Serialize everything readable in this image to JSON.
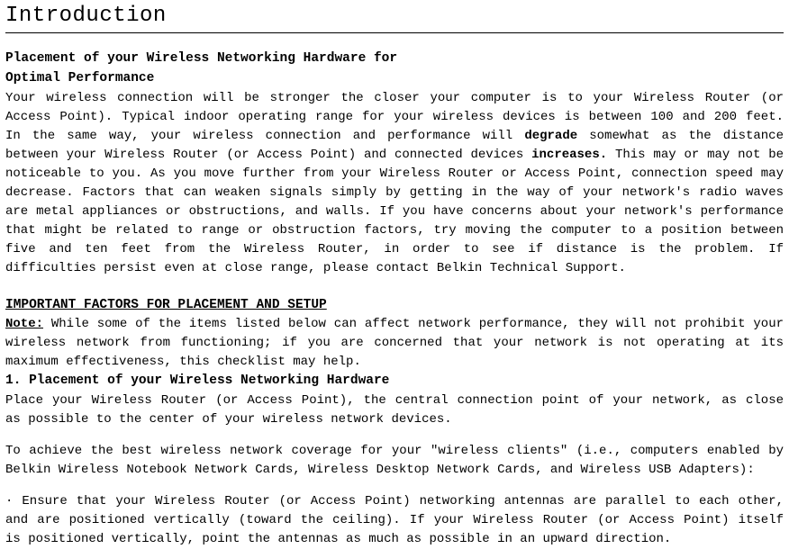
{
  "title": "Introduction",
  "heading_placement_line1": "Placement of your Wireless Networking Hardware for",
  "heading_placement_line2": "Optimal Performance",
  "body1_part1": "Your wireless connection will be stronger the closer your computer is to your Wireless Router (or Access Point). Typical indoor operating range for your wireless devices is between 100 and 200 feet. In the same way, your wireless connection and performance will ",
  "body1_bold1": "degrade",
  "body1_part2": " somewhat as the distance between your Wireless Router (or Access Point) and connected devices ",
  "body1_bold2": "increases.",
  "body1_part3": " This may or may not be noticeable to you. As you move further from your Wireless Router or Access Point, connection speed may decrease. Factors that can weaken signals simply by getting in the way of your network's radio waves are metal appliances or obstructions, and walls. If you have concerns about your network's performance that might be related to range or obstruction factors, try moving the computer to a position between five and ten feet from the Wireless Router, in order to see if distance is the problem. If difficulties persist even at close range, please contact Belkin Technical Support.",
  "heading_important": "IMPORTANT FACTORS FOR PLACEMENT AND SETUP",
  "note_label": "Note:",
  "note_body": " While some of the items listed below can affect network performance, they will not prohibit your wireless network from functioning; if you are concerned that your network is not operating at its maximum effectiveness, this checklist may help.",
  "heading_item1": "1. Placement of your Wireless Networking Hardware",
  "item1_body1": "Place your Wireless Router (or Access Point), the central connection point of your network, as close as possible to the center of your wireless network devices.",
  "item1_body2": "To achieve the best wireless network coverage for your \"wireless clients\" (i.e., computers enabled by Belkin Wireless Notebook Network Cards, Wireless Desktop Network Cards, and Wireless USB Adapters):",
  "bullet_glyph": "·",
  "item1_bullet1": " Ensure that your Wireless Router (or Access Point) networking antennas are parallel to each other, and are positioned vertically (toward the ceiling). If your Wireless Router (or Access Point) itself is positioned vertically, point the antennas as much as possible in an upward direction."
}
